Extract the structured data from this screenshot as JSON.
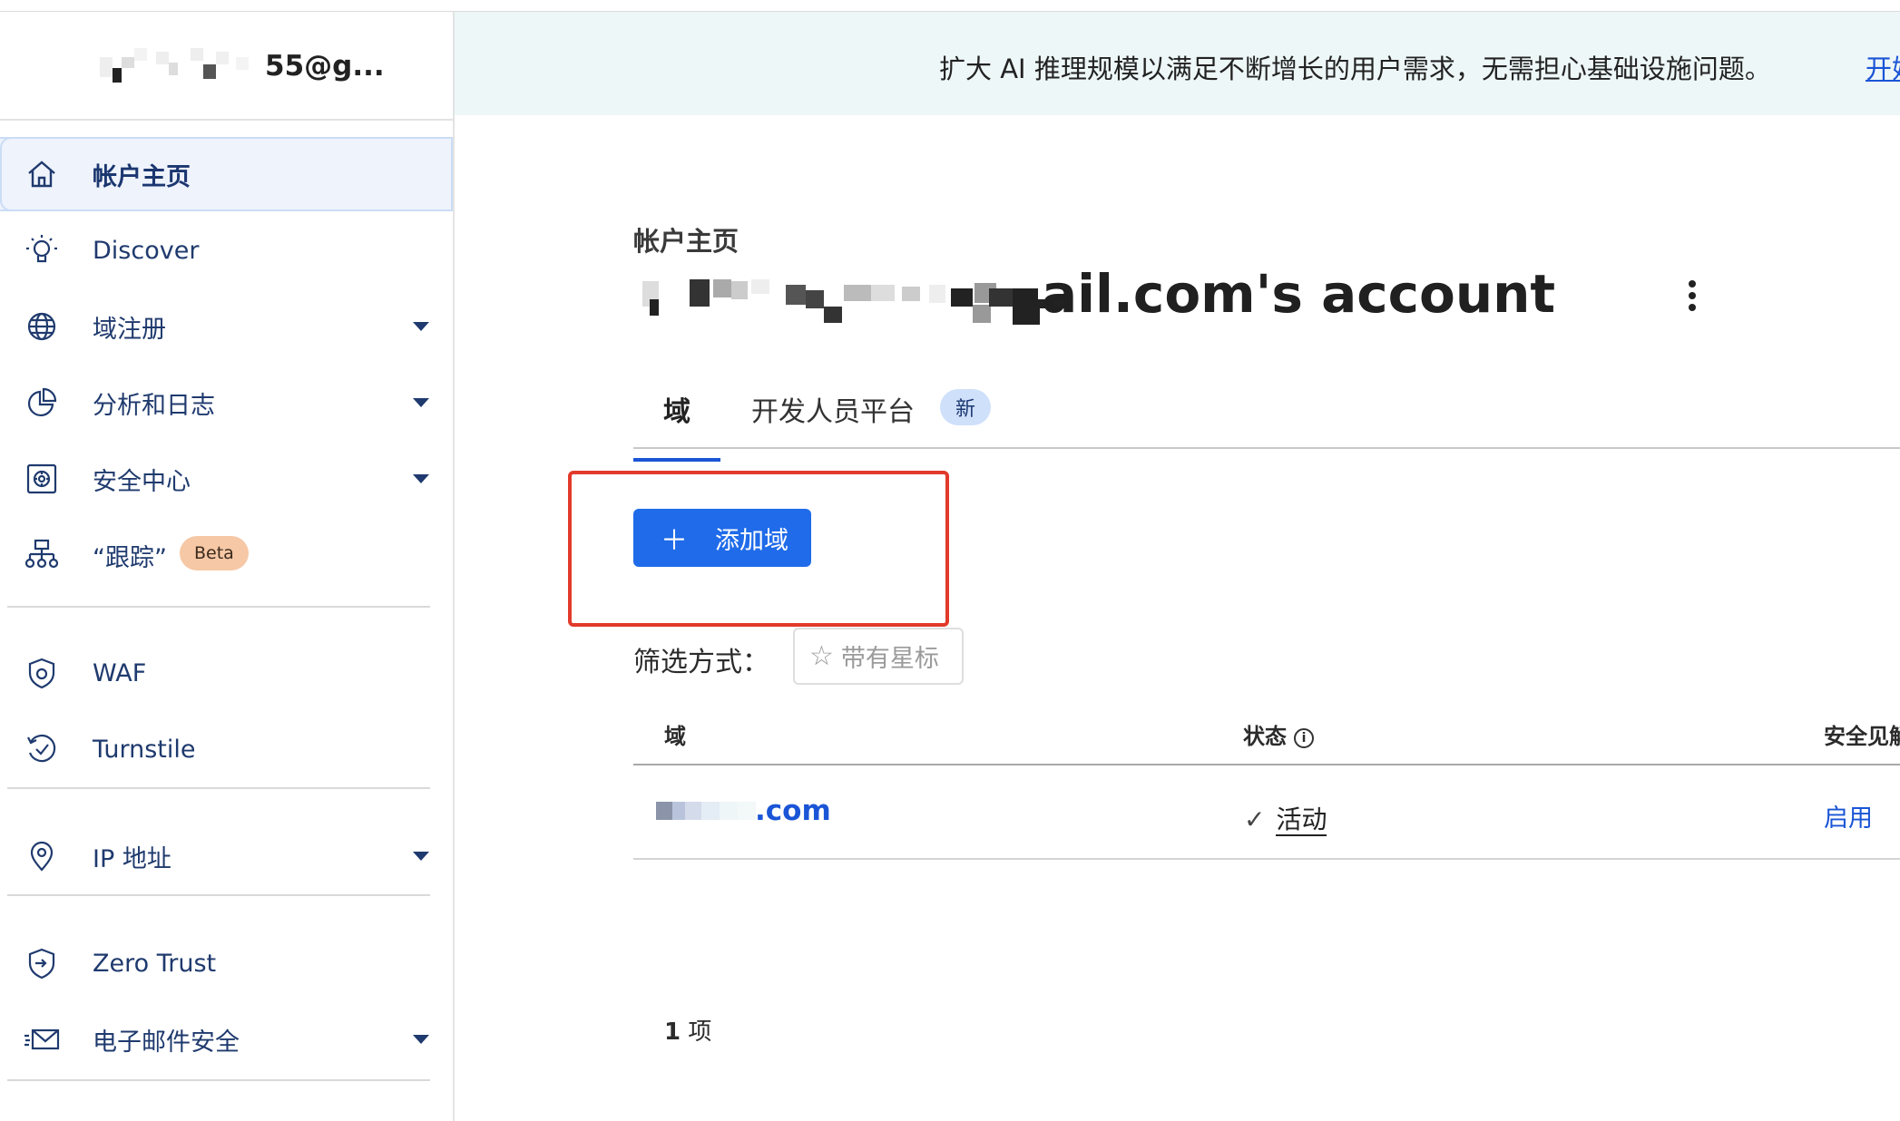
{
  "account": {
    "email_suffix": "55@g..."
  },
  "sidebar": {
    "items": [
      {
        "label": "帐户主页",
        "icon": "home-icon",
        "active": true
      },
      {
        "label": "Discover",
        "icon": "lightbulb-icon"
      },
      {
        "label": "域注册",
        "icon": "globe-icon",
        "expandable": true
      },
      {
        "label": "分析和日志",
        "icon": "pie-chart-icon",
        "expandable": true
      },
      {
        "label": "安全中心",
        "icon": "vault-icon",
        "expandable": true
      },
      {
        "label": "“跟踪”",
        "icon": "trace-icon",
        "badge": "Beta"
      },
      {
        "label": "WAF",
        "icon": "shield-gear-icon"
      },
      {
        "label": "Turnstile",
        "icon": "turnstile-icon"
      },
      {
        "label": "IP 地址",
        "icon": "location-pin-icon",
        "expandable": true
      },
      {
        "label": "Zero Trust",
        "icon": "zero-trust-icon"
      },
      {
        "label": "电子邮件安全",
        "icon": "email-icon",
        "expandable": true
      }
    ]
  },
  "banner": {
    "text": "扩大 AI 推理规模以满足不断增长的用户需求，无需担心基础设施问题。",
    "link": "开始"
  },
  "main": {
    "breadcrumb": "帐户主页",
    "title_suffix": "ail.com's account",
    "tabs": [
      {
        "label": "域",
        "active": true
      },
      {
        "label": "开发人员平台",
        "badge": "新"
      }
    ],
    "add_button": "添加域",
    "filter_label": "筛选方式：",
    "starred_label": "带有星标",
    "table": {
      "headers": [
        "域",
        "状态",
        "安全见解"
      ],
      "rows": [
        {
          "domain": ".com",
          "status": "活动",
          "security": "启用"
        }
      ]
    },
    "count_number": "1",
    "count_unit": "项"
  },
  "colors": {
    "accent": "#1f6be9",
    "link": "#1a55d6",
    "highlight_border": "#e23a2b",
    "banner_bg": "#eef7f8"
  }
}
